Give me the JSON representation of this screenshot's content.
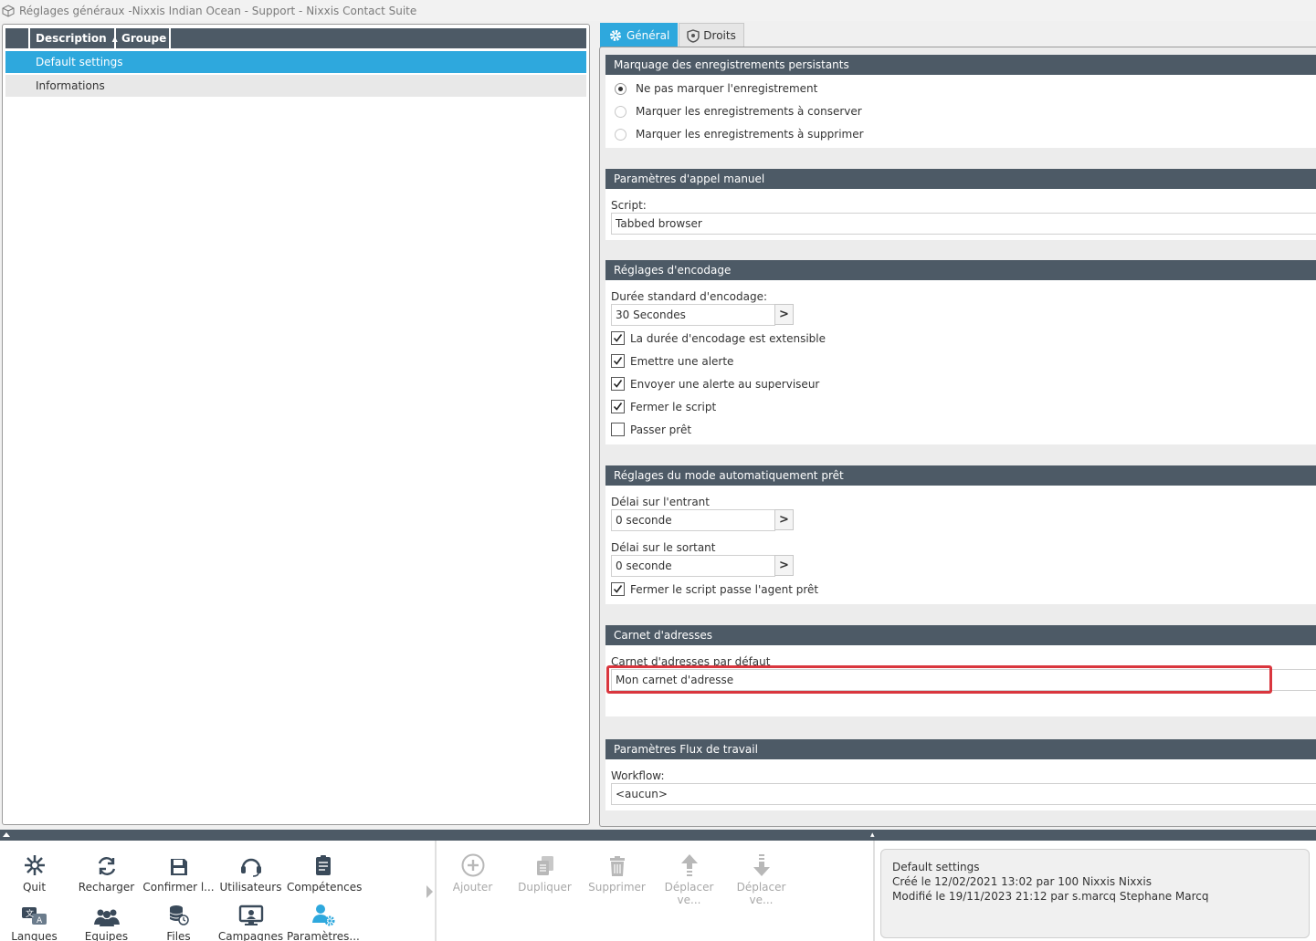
{
  "window": {
    "title": "Réglages généraux -Nixxis Indian Ocean - Support - Nixxis Contact Suite"
  },
  "grid": {
    "columns": [
      "Description",
      "Groupe"
    ],
    "rows": [
      {
        "description": "Default settings",
        "selected": true
      },
      {
        "description": "Informations",
        "selected": false
      }
    ]
  },
  "tabs": [
    {
      "label": "Général",
      "active": true,
      "icon": "gear-icon"
    },
    {
      "label": "Droits",
      "active": false,
      "icon": "shield-icon"
    }
  ],
  "sections": {
    "persist": {
      "title": "Marquage des enregistrements persistants",
      "options": [
        {
          "label": "Ne pas marquer l'enregistrement",
          "checked": true
        },
        {
          "label": "Marquer les enregistrements à conserver",
          "checked": false
        },
        {
          "label": "Marquer les enregistrements à supprimer",
          "checked": false
        }
      ]
    },
    "manual_call": {
      "title": "Paramètres d'appel manuel",
      "script_label": "Script:",
      "script_value": "Tabbed browser"
    },
    "encoding": {
      "title": "Réglages d'encodage",
      "duration_label": "Durée standard d'encodage:",
      "duration_value": "30 Secondes",
      "checks": [
        {
          "label": "La durée d'encodage est extensible",
          "checked": true
        },
        {
          "label": "Emettre une alerte",
          "checked": true
        },
        {
          "label": "Envoyer une alerte au superviseur",
          "checked": true
        },
        {
          "label": "Fermer le script",
          "checked": true
        },
        {
          "label": "Passer prêt",
          "checked": false
        }
      ]
    },
    "auto_ready": {
      "title": "Réglages du mode automatiquement prêt",
      "inbound_label": "Délai sur l'entrant",
      "inbound_value": "0 seconde",
      "outbound_label": "Délai sur le sortant",
      "outbound_value": "0 seconde",
      "close_check": {
        "label": "Fermer le script passe l'agent prêt",
        "checked": true
      }
    },
    "address_book": {
      "title": "Carnet d'adresses",
      "default_label": "Carnet d'adresses par défaut",
      "default_value": "Mon carnet d'adresse"
    },
    "workflow": {
      "title": "Paramètres Flux de travail",
      "workflow_label": "Workflow:",
      "workflow_value": "<aucun>"
    }
  },
  "toolbar": {
    "buttons": [
      {
        "label": "Quit",
        "icon": "quit-icon"
      },
      {
        "label": "Recharger",
        "icon": "reload-icon"
      },
      {
        "label": "Confirmer l...",
        "icon": "save-icon"
      },
      {
        "label": "Utilisateurs",
        "icon": "headset-icon"
      },
      {
        "label": "Compétences",
        "icon": "skills-icon"
      },
      {
        "label": "Langues",
        "icon": "languages-icon"
      },
      {
        "label": "Equipes",
        "icon": "teams-icon"
      },
      {
        "label": "Files d'atten...",
        "icon": "queues-icon"
      },
      {
        "label": "Campagnes",
        "icon": "campaigns-icon"
      },
      {
        "label": "Paramètres...",
        "icon": "user-settings-icon"
      }
    ],
    "actions": [
      {
        "label": "Ajouter",
        "icon": "add-icon"
      },
      {
        "label": "Dupliquer",
        "icon": "duplicate-icon"
      },
      {
        "label": "Supprimer",
        "icon": "delete-icon"
      },
      {
        "label": "Déplacer ve...",
        "icon": "move-up-icon"
      },
      {
        "label": "Déplacer ve...",
        "icon": "move-down-icon"
      }
    ]
  },
  "info": {
    "name": "Default settings",
    "created": "Créé le 12/02/2021 13:02 par 100 Nixxis  Nixxis",
    "modified": "Modifié le 19/11/2023 21:12 par s.marcq Stephane Marcq"
  },
  "colors": {
    "accent": "#2ea8dd",
    "header": "#4d5a66",
    "highlight": "#d9363e"
  }
}
